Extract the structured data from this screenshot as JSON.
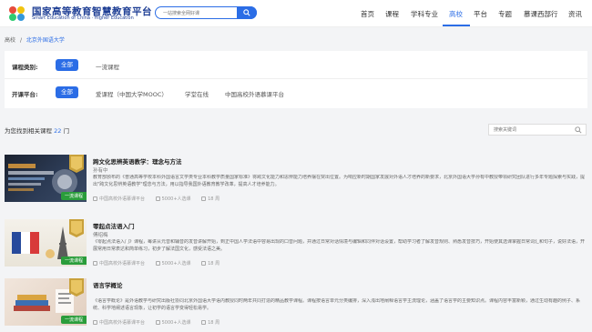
{
  "header": {
    "logo_cn": "国家高等教育智慧教育平台",
    "logo_en": "Smart Education of China · Higher Education",
    "search_placeholder": "一站搜索全网好课",
    "nav": [
      {
        "label": "首页"
      },
      {
        "label": "课程"
      },
      {
        "label": "学科专业"
      },
      {
        "label": "高校"
      },
      {
        "label": "平台"
      },
      {
        "label": "专题"
      },
      {
        "label": "慕课西部行"
      },
      {
        "label": "资讯"
      }
    ],
    "active_nav": "高校"
  },
  "breadcrumb": {
    "root": "高校",
    "separator": "/",
    "current": "北京外国语大学"
  },
  "filters": {
    "category_label": "课程类别:",
    "category_options": [
      "全部",
      "一流课程"
    ],
    "platform_label": "开课平台:",
    "platform_options": [
      "全部",
      "爱课程（中国大学MOOC）",
      "学堂在线",
      "中国高校外语慕课平台"
    ]
  },
  "results": {
    "prefix": "为您找到相关课程",
    "count": "22",
    "suffix": "门",
    "search_placeholder": "搜索关键词"
  },
  "courses": [
    {
      "title": "跨文化思辨英语教学：理念与方法",
      "teacher": "孙有中",
      "description": "教育部颁布的《普通高等学校本科外国语言文学类专业本科教学质量国家标准》将跨文化能力和思辨能力培养摆在突出位置。为响应新时期国家发展对外语人才培养的新要求，北京外国语大学孙有中教授带领研究团队进行多年专题探索与实践，提出\"跨文化思辨英语教学\"理念与方法，用以指导我国外语教育教学改革，提高人才培养能力。",
      "platform": "中国高校外语慕课平台",
      "enrolled": "5000+人选课",
      "lessons": "18 周",
      "tag": "一流课程"
    },
    {
      "title": "零起点法语入门",
      "teacher": "傅绍梅",
      "description": "《零起点法语入门》课程，每讲从元音和辅音的发音讲解开始，到正中国人学法语中容易出现的口音问题，并通过日常对话情境与编辑和同伴对话设置，帮助学习者了解发音规则、熟悉发音技巧，开始使其选课掌握日常词汇和句子，说好法语，开展常用日常表达和简单练习，初步了解法国文化，感受法语之美。",
      "platform": "中国高校外语慕课平台",
      "enrolled": "5000+人选课",
      "lessons": "18 周",
      "tag": "一流课程"
    },
    {
      "title": "语言学概论",
      "teacher": "",
      "description": "《语言学概论》是外语教学与研究出版社协同北京外国语大学语内教授同时两年共同打造的精品教学课程。课程按语言单元分类编排，深入浅出地阐释语言学主流理论，涵盖了语言学的主要知识点。课程内容丰富新颖，通过生动有趣的例子、系统、科学地阐述语言现象，让初学的语言学变得轻松易学。",
      "platform": "中国高校外语慕课平台",
      "enrolled": "5000+人选课",
      "lessons": "18 周",
      "tag": "一流课程"
    }
  ],
  "colors": {
    "accent": "#2b6de6",
    "brand": "#1f3f95",
    "tag_green": "#2a9d3b"
  }
}
